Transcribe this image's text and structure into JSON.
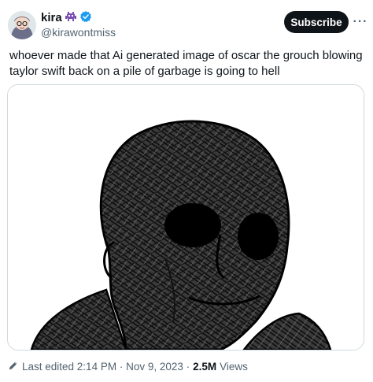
{
  "author": {
    "display_name": "kira",
    "handle": "@kirawontmiss",
    "badge_emoji_icon": "alien-monster-icon",
    "verified_icon": "verified-badge-icon",
    "verified_color": "#1d9bf0"
  },
  "header": {
    "subscribe_label": "Subscribe",
    "more_label": "···"
  },
  "tweet": {
    "text": "whoever made that Ai generated image of oscar the grouch blowing taylor swift back on a pile of garbage is going to hell"
  },
  "footer": {
    "edited_label": "Last edited 2:14 PM · Nov 9, 2023 ·",
    "views_count": "2.5M",
    "views_label": "Views"
  },
  "colors": {
    "text": "#0f1419",
    "secondary": "#536471",
    "button_bg": "#0f1419"
  }
}
